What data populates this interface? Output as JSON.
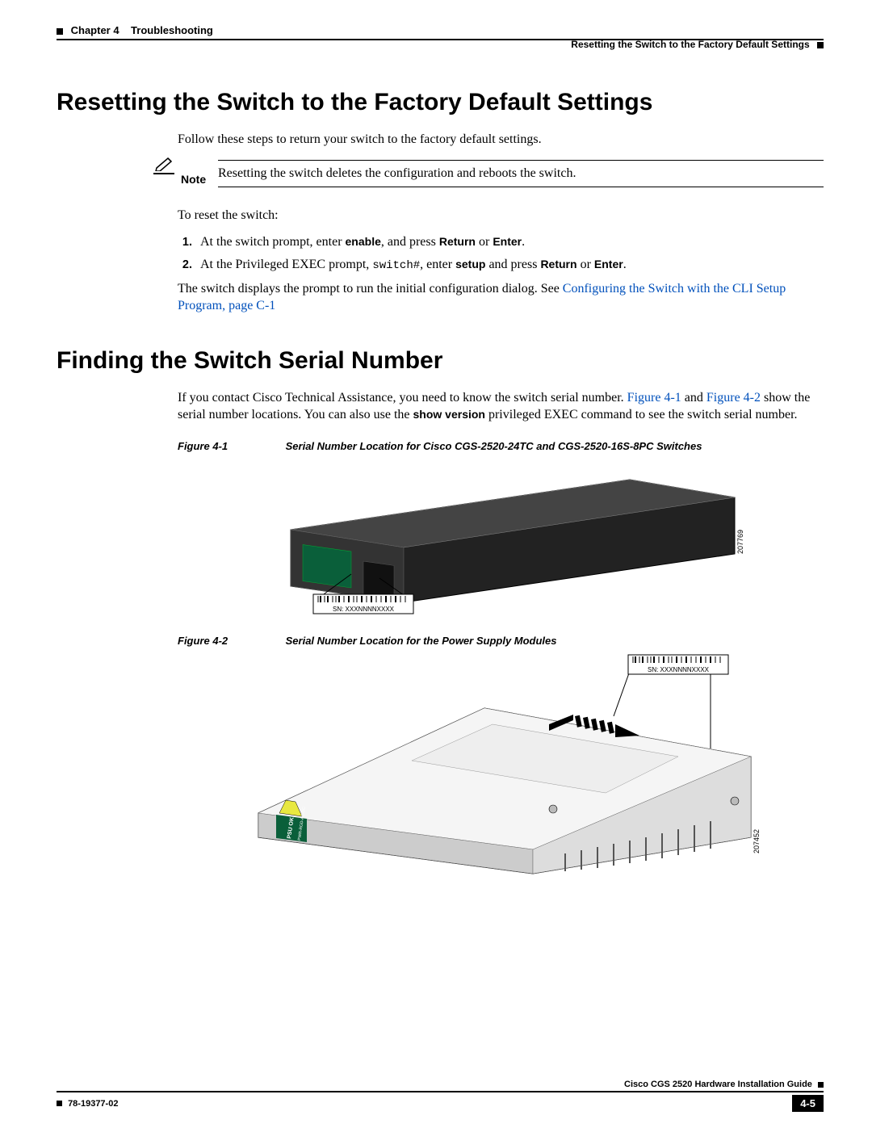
{
  "header": {
    "chapter_label": "Chapter 4",
    "chapter_title": "Troubleshooting",
    "section_title": "Resetting the Switch to the Factory Default Settings"
  },
  "section1": {
    "heading": "Resetting the Switch to the Factory Default Settings",
    "intro": "Follow these steps to return your switch to the factory default settings.",
    "note_label": "Note",
    "note_body": "Resetting the switch deletes the configuration and reboots the switch.",
    "to_reset": "To reset the switch:",
    "step1_pre": "At the switch prompt, enter ",
    "step1_b1": "enable",
    "step1_mid": ", and press ",
    "step1_b2": "Return",
    "step1_or": " or ",
    "step1_b3": "Enter",
    "step1_end": ".",
    "step2_pre": "At the Privileged EXEC prompt, ",
    "step2_mono": "switch#",
    "step2_mid1": ", enter ",
    "step2_b1": "setup",
    "step2_mid2": " and press ",
    "step2_b2": "Return",
    "step2_or": " or ",
    "step2_b3": "Enter",
    "step2_end": ".",
    "after_pre": "The switch displays the prompt to run the initial configuration dialog. See ",
    "after_link": "Configuring the Switch with the CLI Setup Program, page C-1"
  },
  "section2": {
    "heading": "Finding the Switch Serial Number",
    "p1_pre": "If you contact Cisco Technical Assistance, you need to know the switch serial number. ",
    "p1_link1": "Figure 4-1",
    "p1_mid1": " and ",
    "p1_link2": "Figure 4-2",
    "p1_mid2": " show the serial number locations. You can also use the ",
    "p1_b1": "show version",
    "p1_end": " privileged EXEC command to see the switch serial number.",
    "fig1_label": "Figure 4-1",
    "fig1_caption": "Serial Number Location for Cisco CGS-2520-24TC and CGS-2520-16S-8PC Switches",
    "fig1_sn": "SN: XXXNNNNXXXX",
    "fig1_id": "207769",
    "fig2_label": "Figure 4-2",
    "fig2_caption": "Serial Number Location for the Power Supply Modules",
    "fig2_sn": "SN: XXXNNNNXXXX",
    "fig2_psu": "PSU OK",
    "fig2_model": "PWR-RGD-AC-DC",
    "fig2_id": "207452"
  },
  "footer": {
    "guide_title": "Cisco CGS 2520 Hardware Installation Guide",
    "doc_number": "78-19377-02",
    "page_number": "4-5"
  }
}
